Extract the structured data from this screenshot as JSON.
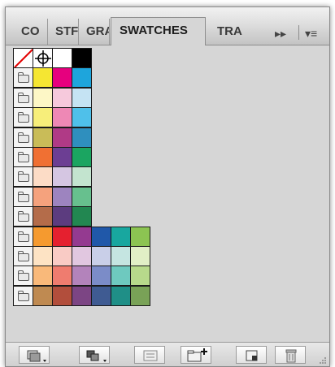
{
  "tabs": [
    {
      "label": "CO"
    },
    {
      "label": "STF"
    },
    {
      "label": "GRA"
    },
    {
      "label": "SWATCHES"
    },
    {
      "label": "TRA"
    }
  ],
  "tab_controls": {
    "collapse": "▸▸",
    "menu": "▾≡"
  },
  "swatches": {
    "special": [
      "None",
      "Registration",
      "#ffffff",
      "#000000"
    ],
    "groups": [
      [
        "#f5e632",
        "#e6007e",
        "#1ea5dc"
      ],
      [
        "#fdf7c6",
        "#f6c9dc",
        "#c5e3f3"
      ],
      [
        "#f7ee7a",
        "#ee88b5",
        "#4fc0ea"
      ],
      [
        "#c9bc58",
        "#b03a86",
        "#2f8fbe"
      ],
      [
        "#f07033",
        "#6c3e93",
        "#1ba561"
      ],
      [
        "#fcdcc6",
        "#d5c6e2",
        "#c3e4cf"
      ],
      [
        "#f5a27d",
        "#9d84bf",
        "#67c08e"
      ],
      [
        "#b46c4a",
        "#5c3c7f",
        "#228751"
      ],
      [
        "#f59a2f",
        "#e5202f",
        "#943a90",
        "#2058a9",
        "#18a79f",
        "#8cc452"
      ],
      [
        "#fde3c4",
        "#f9cbc5",
        "#e1c7e0",
        "#c9cfe8",
        "#c5e5e1",
        "#e1efc6"
      ],
      [
        "#f9b97a",
        "#ef7c6f",
        "#b383bb",
        "#7b8cc8",
        "#6ec9bf",
        "#b7d98b"
      ],
      [
        "#bf8a51",
        "#b24e3c",
        "#7c4584",
        "#3f5b92",
        "#1f8f87",
        "#79a257"
      ]
    ]
  },
  "bottom_buttons": [
    "swatch-libraries-menu",
    "show-swatch-kinds-menu",
    "swatch-options",
    "new-color-group",
    "new-swatch",
    "delete-swatch"
  ]
}
